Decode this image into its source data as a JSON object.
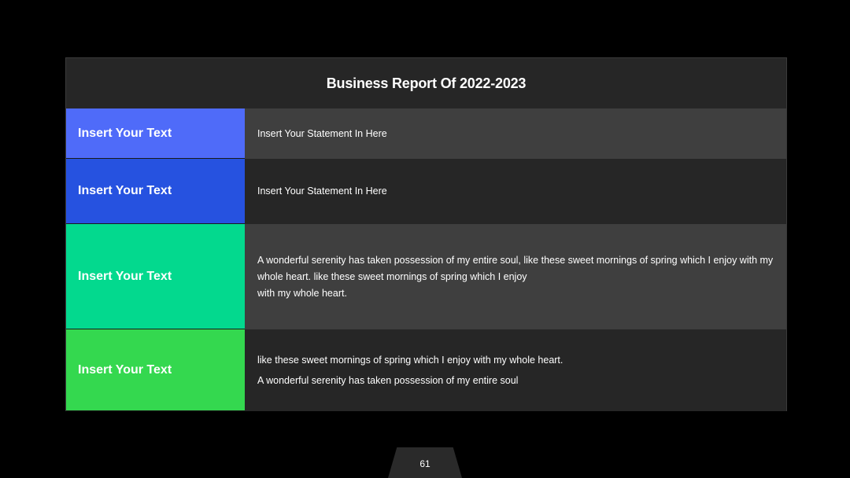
{
  "report": {
    "title": "Business Report Of 2022-2023",
    "rows": [
      {
        "label": "Insert Your Text",
        "label_color": "#4F6BF9",
        "paragraphs": [
          "Insert Your Statement In Here"
        ]
      },
      {
        "label": "Insert Your Text",
        "label_color": "#2652E0",
        "paragraphs": [
          "Insert Your Statement In Here"
        ]
      },
      {
        "label": "Insert Your Text",
        "label_color": "#03D98E",
        "paragraphs": [
          "A wonderful serenity has taken possession of my entire soul, like these sweet mornings of spring which I enjoy with my whole heart. like these sweet mornings of spring which I enjoy\nwith my whole heart."
        ]
      },
      {
        "label": "Insert Your Text",
        "label_color": "#34D84F",
        "paragraphs": [
          "like these sweet mornings of spring which I enjoy with my whole heart.",
          "A wonderful serenity has taken possession of my entire soul"
        ]
      }
    ]
  },
  "footer": {
    "page_number": "61"
  }
}
